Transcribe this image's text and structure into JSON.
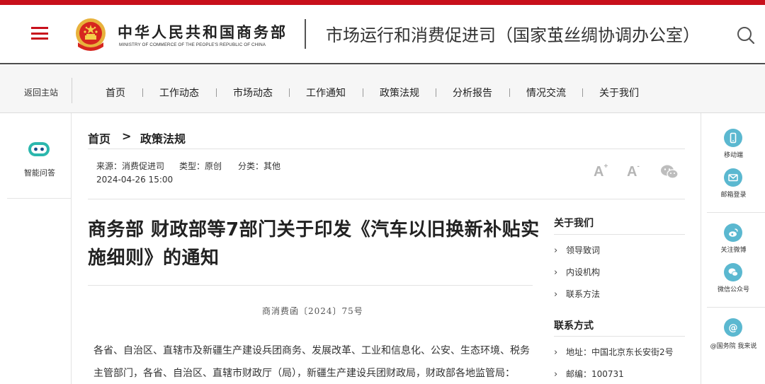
{
  "header": {
    "brand_cn": "中华人民共和国商务部",
    "brand_en": "MINISTRY OF COMMERCE OF THE PEOPLE'S REPUBLIC OF CHINA",
    "dept_title": "市场运行和消费促进司（国家茧丝绸协调办公室）",
    "icons": [
      "menu-icon",
      "national-emblem-icon",
      "search-icon"
    ],
    "accent_color": "#c8101b"
  },
  "nav": {
    "back_label": "返回主站",
    "items": [
      "首页",
      "工作动态",
      "市场动态",
      "工作通知",
      "政策法规",
      "分析报告",
      "情况交流",
      "关于我们"
    ]
  },
  "left_rail": {
    "assistant_label": "智能问答",
    "icon": "robot-icon"
  },
  "right_rail": {
    "items": [
      {
        "label": "移动端",
        "icon": "mobile-icon"
      },
      {
        "label": "邮箱登录",
        "icon": "mail-icon"
      },
      {
        "label": "关注微博",
        "icon": "weibo-icon"
      },
      {
        "label": "微信公众号",
        "icon": "wechat-icon"
      },
      {
        "label": "@国务院 我来说",
        "icon": "at-icon"
      }
    ],
    "icon_color": "#5bb8d0"
  },
  "breadcrumb": {
    "home": "首页",
    "separator": ">",
    "current": "政策法规"
  },
  "meta": {
    "source": "来源：消费促进司",
    "type": "类型：原创",
    "category": "分类：其他",
    "date": "2024-04-26 15:00",
    "font_larger": "A",
    "font_smaller": "A"
  },
  "article": {
    "title": "商务部 财政部等7部门关于印发《汽车以旧换新补贴实施细则》的通知",
    "doc_number": "商消费函〔2024〕75号",
    "body_lines": [
      "各省、自治区、直辖市及新疆生产建设兵团商务、发展改革、工业和信息化、公安、生态环境、税务",
      "主管部门，各省、自治区、直辖市财政厅（局），新疆生产建设兵团财政局，财政部各地监管局："
    ]
  },
  "sidebar": {
    "about_heading": "关于我们",
    "about_items": [
      "领导致词",
      "内设机构",
      "联系方法"
    ],
    "contact_heading": "联系方式",
    "contact_items": [
      "地址：中国北京东长安街2号",
      "邮编：100731"
    ]
  }
}
